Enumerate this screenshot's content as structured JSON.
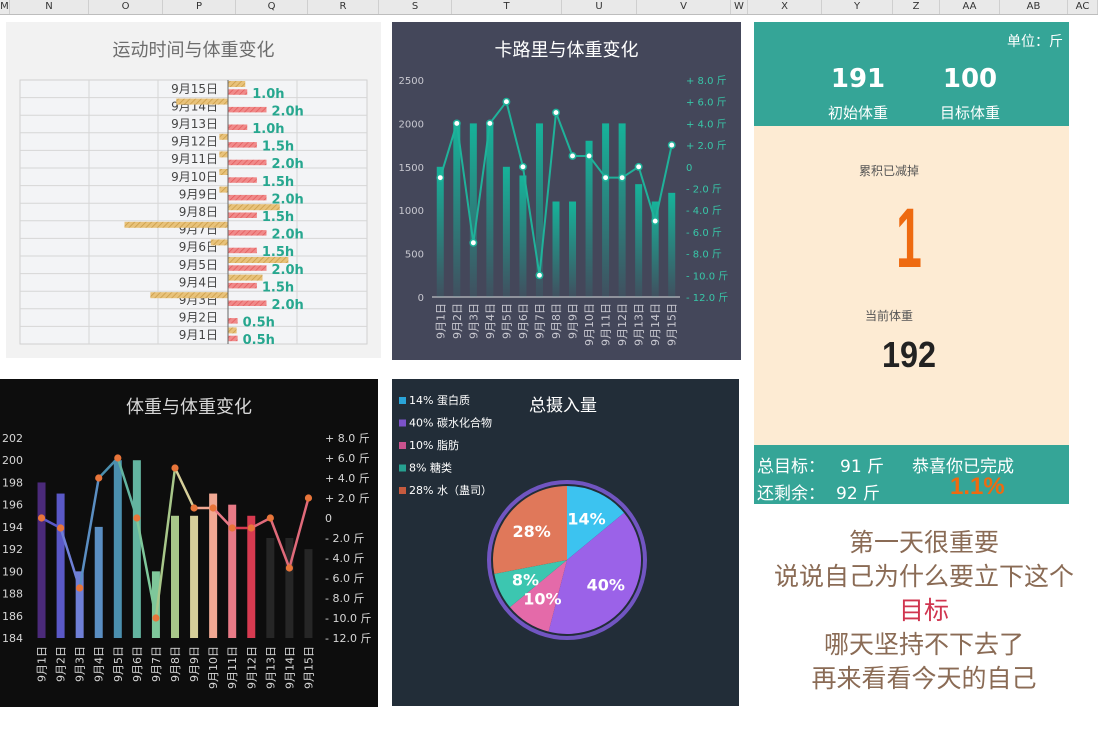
{
  "columns": [
    "M",
    "N",
    "O",
    "P",
    "Q",
    "R",
    "S",
    "T",
    "U",
    "V",
    "W",
    "X",
    "Y",
    "Z",
    "AA",
    "AB",
    "AC"
  ],
  "days": [
    "9月1日",
    "9月2日",
    "9月3日",
    "9月4日",
    "9月5日",
    "9月6日",
    "9月7日",
    "9月8日",
    "9月9日",
    "9月10日",
    "9月11日",
    "9月12日",
    "9月13日",
    "9月14日",
    "9月15日"
  ],
  "exercise_panel": {
    "title": "运动时间与体重变化",
    "hours": [
      0.5,
      0.5,
      2.0,
      1.5,
      2.0,
      1.5,
      2.0,
      1.5,
      2.0,
      1.5,
      2.0,
      1.5,
      1.0,
      2.0,
      1.0
    ],
    "hour_labels": [
      "0.5h",
      "0.5h",
      "2.0h",
      "1.5h",
      "2.0h",
      "1.5h",
      "2.0h",
      "1.5h",
      "2.0h",
      "1.5h",
      "2.0h",
      "1.5h",
      "1.0h",
      "2.0h",
      "1.0h"
    ],
    "weight_change": [
      0.5,
      0,
      -4.5,
      2.0,
      3.5,
      -1.0,
      -6.0,
      3.0,
      -0.5,
      -0.5,
      -0.5,
      -0.5,
      0,
      -3.0,
      1.0
    ]
  },
  "calorie_panel": {
    "title": "卡路里与体重变化",
    "left_ticks": [
      "2500",
      "2000",
      "1500",
      "1000",
      "500",
      "0"
    ],
    "right_ticks": [
      "+ 8.0 斤",
      "+ 6.0 斤",
      "+ 4.0 斤",
      "+ 2.0 斤",
      "0",
      "- 2.0 斤",
      "- 4.0 斤",
      "- 6.0 斤",
      "- 8.0 斤",
      "- 10.0 斤",
      "- 12.0 斤"
    ],
    "calories": [
      1500,
      2000,
      2000,
      2000,
      1500,
      1400,
      2000,
      1100,
      1100,
      1800,
      2000,
      2000,
      1300,
      1100,
      1200
    ],
    "weight_change": [
      -1.0,
      4.0,
      -7.0,
      4.0,
      6.0,
      0,
      -10.0,
      5.0,
      1.0,
      1.0,
      -1.0,
      -1.0,
      0,
      -5.0,
      2.0
    ]
  },
  "summary": {
    "unit": "单位：斤",
    "start_weight": "191",
    "start_label": "初始体重",
    "target_weight": "100",
    "target_label": "目标体重",
    "lost_label": "累积已减掉",
    "lost_value": "1",
    "current_label": "当前体重",
    "current_value": "192",
    "total_goal_label": "总目标：",
    "total_goal_value": "91 斤",
    "congrats": "恭喜你已完成",
    "remaining_label": "还剩余：",
    "remaining_value": "92 斤",
    "percent": "1.1%",
    "colors": {
      "teal": "#35a597",
      "cream": "#fdebd3",
      "orange": "#ee6a10"
    }
  },
  "weight_panel": {
    "title": "体重与体重变化",
    "left_ticks": [
      "202",
      "200",
      "198",
      "196",
      "194",
      "192",
      "190",
      "188",
      "186",
      "184"
    ],
    "right_ticks": [
      "+ 8.0 斤",
      "+ 6.0 斤",
      "+ 4.0 斤",
      "+ 2.0 斤",
      "0",
      "- 2.0 斤",
      "- 4.0 斤",
      "- 6.0 斤",
      "- 8.0 斤",
      "- 10.0 斤",
      "- 12.0 斤"
    ],
    "weights": [
      198,
      197,
      190,
      194,
      200,
      200,
      190,
      195,
      195,
      197,
      196,
      195,
      193,
      193,
      192
    ],
    "weight_change": [
      0,
      -1.0,
      -7.0,
      4.0,
      6.0,
      0,
      -10.0,
      5.0,
      1.0,
      1.0,
      -1.0,
      -1.0,
      0,
      -5.0,
      2.0
    ],
    "bar_colors": [
      "#4b2a7a",
      "#5a58c6",
      "#6f7fd6",
      "#5a8ec2",
      "#4b8fae",
      "#63b4a0",
      "#7ec79a",
      "#a8c78a",
      "#d6cf9a",
      "#f0a893",
      "#e87a86",
      "#d73a50",
      "#262626",
      "#262626",
      "#262626"
    ]
  },
  "intake_panel": {
    "title": "总摄入量",
    "legend": [
      "14% 蛋白质",
      "40% 碳水化合物",
      "10% 脂肪",
      "8% 糖类",
      "28% 水（蛊司）"
    ],
    "values": [
      14,
      40,
      10,
      8,
      28
    ],
    "labels": [
      "14%",
      "40%",
      "10%",
      "8%",
      "28%"
    ],
    "colors": [
      "#3cc3f0",
      "#9b62e8",
      "#e46aa9",
      "#3cc6b0",
      "#e0785a"
    ],
    "legend_colors": [
      "#2aa4d8",
      "#7b52c9",
      "#c8528e",
      "#26a090",
      "#c65a3e"
    ]
  },
  "motto": {
    "line1": "第一天很重要",
    "line2": "说说自己为什么要立下这个",
    "line3": "目标",
    "line4": "哪天坚持不下去了",
    "line5": "再来看看今天的自己"
  }
}
